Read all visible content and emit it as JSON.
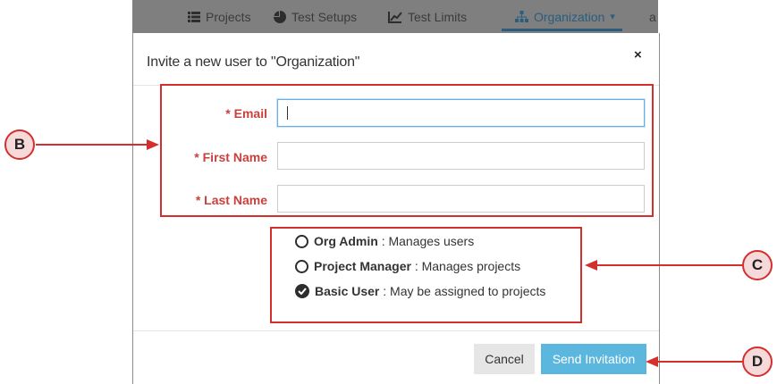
{
  "nav": {
    "items": [
      {
        "label": "Projects",
        "icon": "list-icon"
      },
      {
        "label": "Test Setups",
        "icon": "pie-chart-icon"
      },
      {
        "label": "Test Limits",
        "icon": "line-chart-icon"
      },
      {
        "label": "Organization",
        "icon": "sitemap-icon",
        "caret": "▾",
        "active": true
      },
      {
        "label": "a"
      }
    ]
  },
  "modal": {
    "title": "Invite a new user to \"Organization\"",
    "close_label": "×",
    "fields": [
      {
        "label": "* Email",
        "value": "",
        "focused": true
      },
      {
        "label": "* First Name",
        "value": ""
      },
      {
        "label": "* Last Name",
        "value": ""
      }
    ],
    "roles": [
      {
        "name": "Org Admin",
        "description": " : Manages users",
        "selected": false
      },
      {
        "name": "Project Manager",
        "description": " : Manages projects",
        "selected": false
      },
      {
        "name": "Basic User",
        "description": " : May be assigned to projects",
        "selected": true
      }
    ],
    "cancel_label": "Cancel",
    "send_label": "Send Invitation"
  },
  "callouts": {
    "b": "B",
    "c": "C",
    "d": "D"
  },
  "colors": {
    "accent": "#5bb7de",
    "callout_red": "#d32f2f",
    "label_red": "#c9403d",
    "nav_active": "#2a5d7e"
  }
}
